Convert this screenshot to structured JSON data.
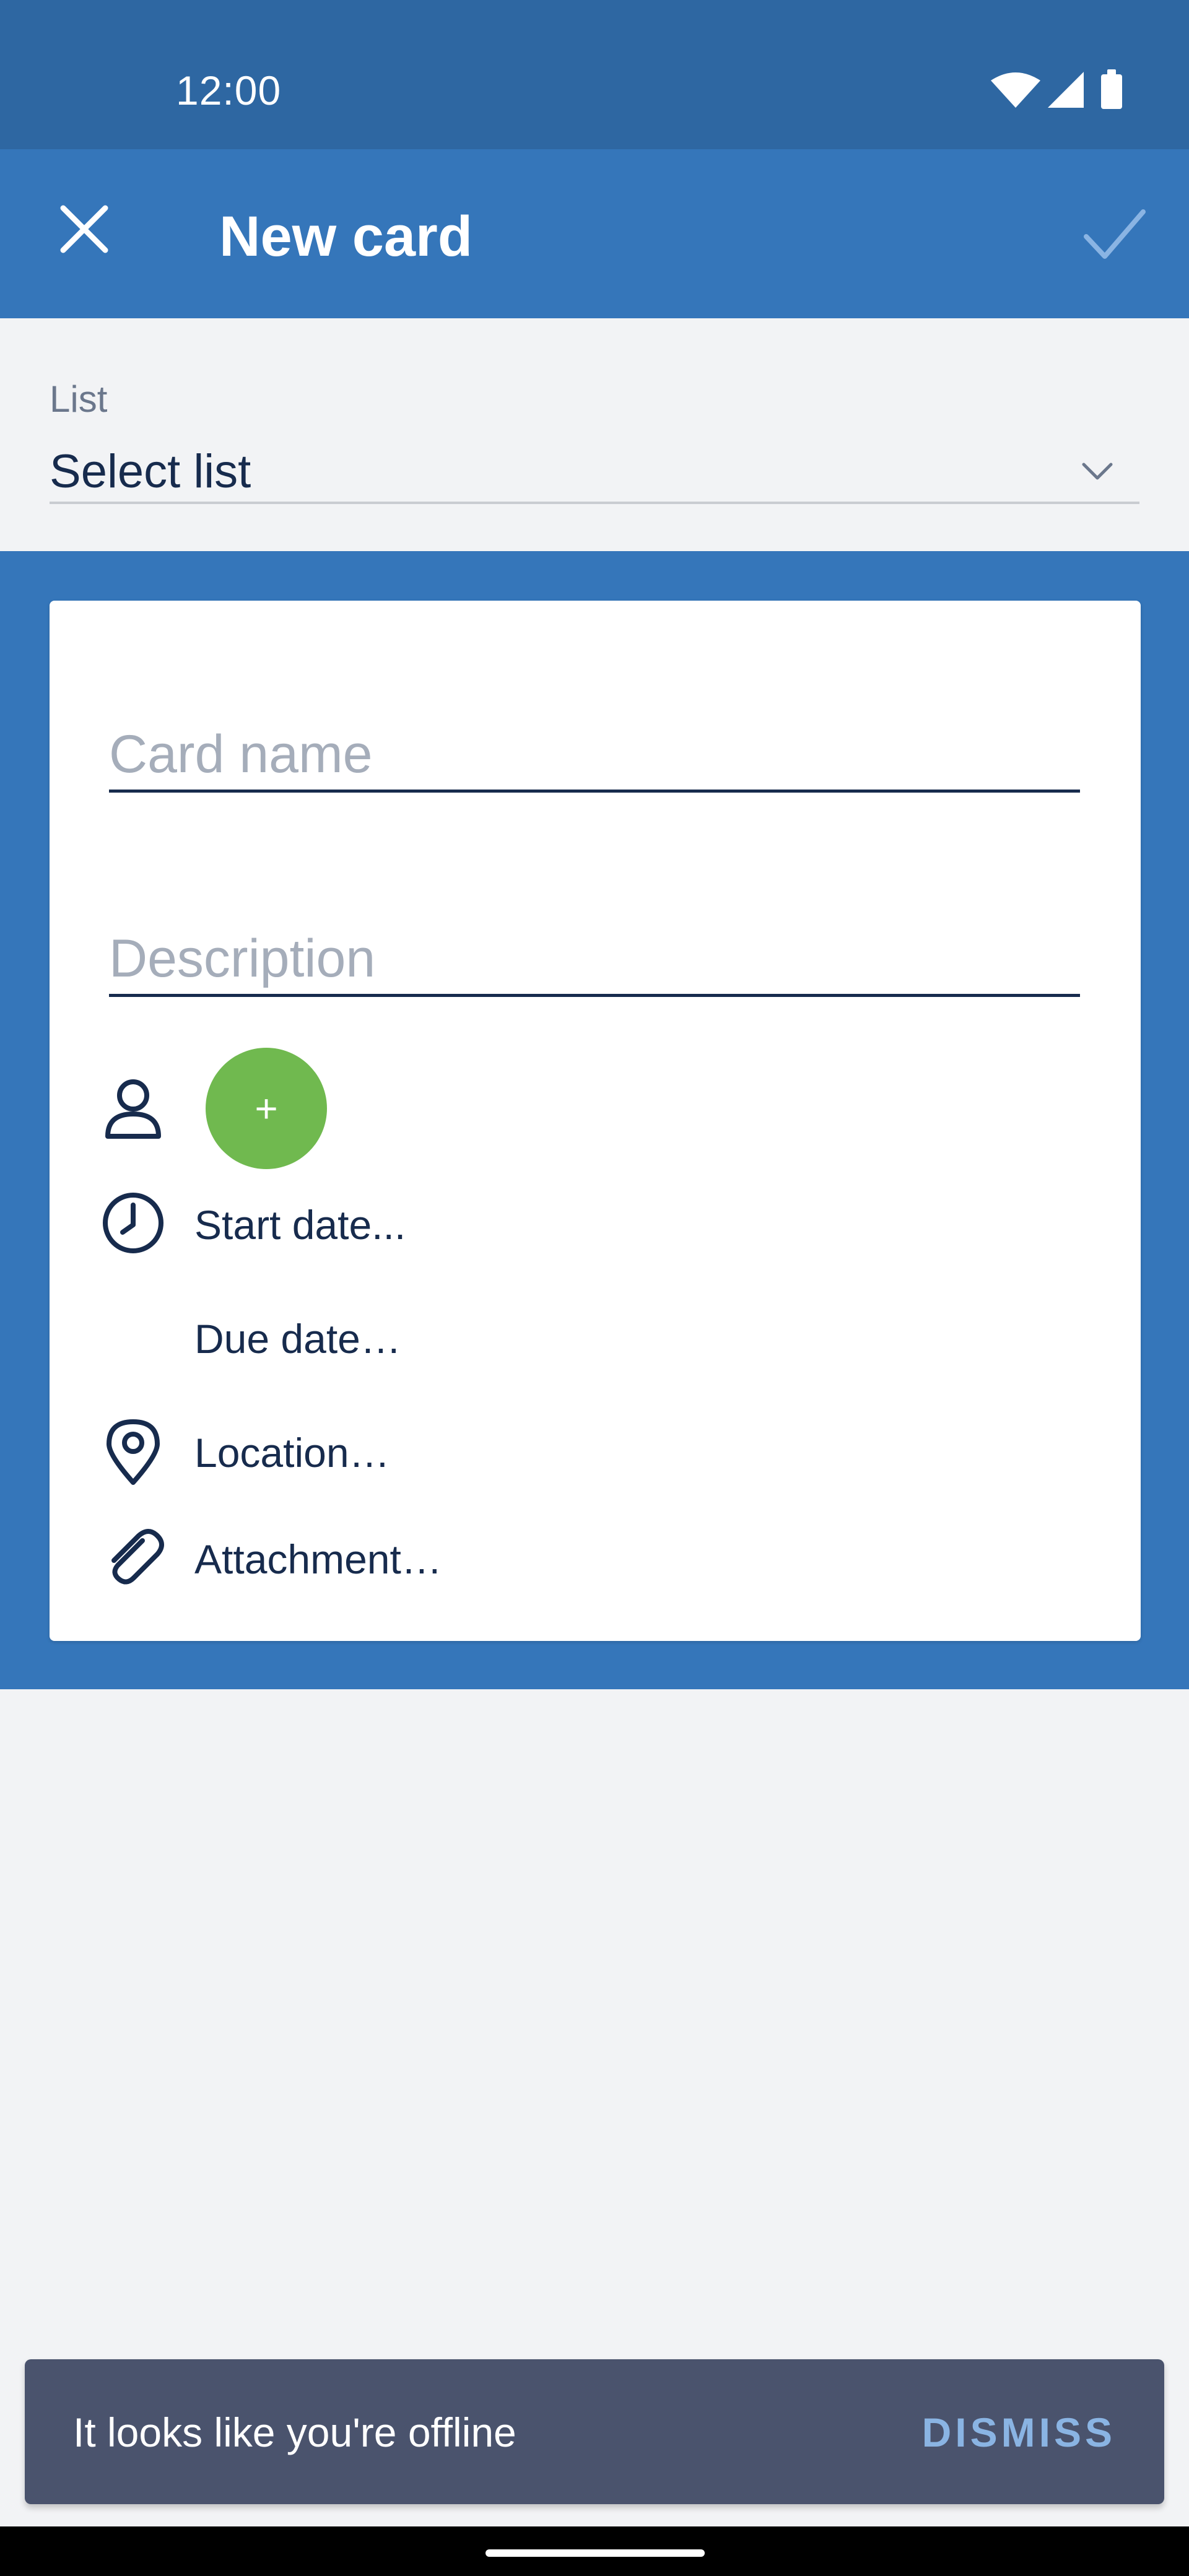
{
  "status_bar": {
    "time": "12:00",
    "icons": [
      "wifi-icon",
      "signal-icon",
      "battery-icon"
    ]
  },
  "app_bar": {
    "title": "New card",
    "close_icon": "close-icon",
    "confirm_icon": "check-icon"
  },
  "list_selector": {
    "label": "List",
    "value": "Select list",
    "icon": "chevron-down-icon"
  },
  "card": {
    "name_placeholder": "Card name",
    "description_placeholder": "Description",
    "add_member_label": "+",
    "start_date": "Start date...",
    "due_date": "Due date…",
    "location": "Location…",
    "attachment": "Attachment…"
  },
  "snackbar": {
    "message": "It looks like you're offline",
    "action": "DISMISS"
  },
  "colors": {
    "status_bar": "#2e67a2",
    "app_bar": "#3576ba",
    "accent_green": "#70b94f",
    "text_dark": "#172b4d",
    "snackbar_bg": "#4a536d",
    "snackbar_action": "#8ab4e3"
  }
}
